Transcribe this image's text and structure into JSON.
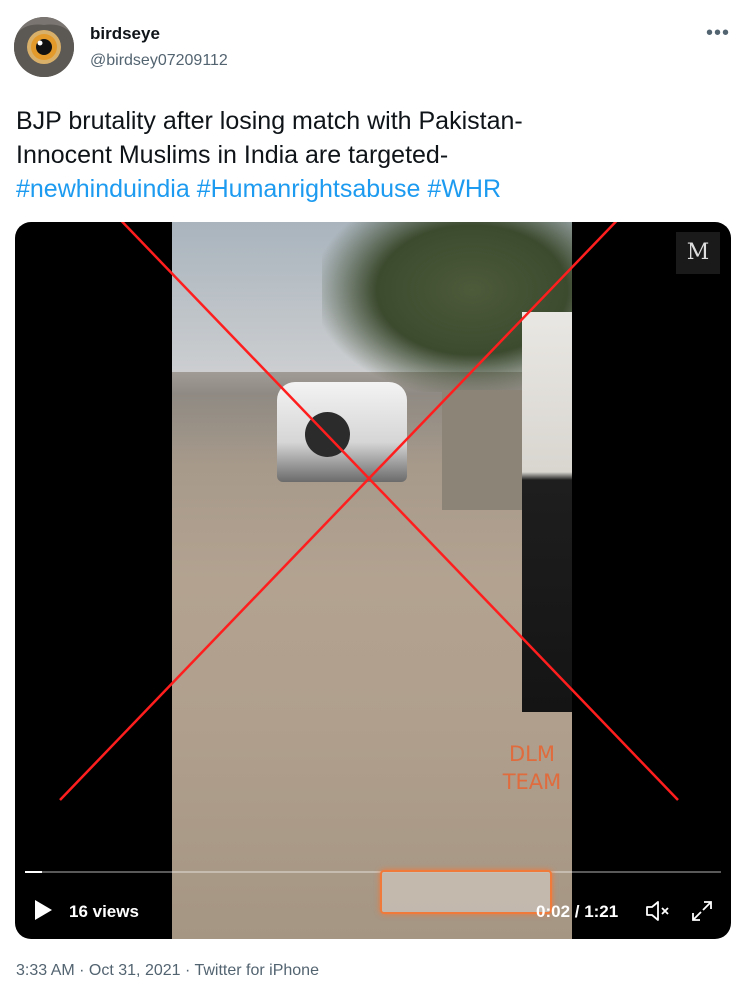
{
  "author": {
    "display_name": "birdseye",
    "handle": "@birdsey07209112"
  },
  "tweet": {
    "line1": "BJP brutality after losing match with Pakistan-",
    "line2": "Innocent Muslims in India are targeted-",
    "hashtags": [
      "#newhinduindia",
      "#Humanrightsabuse",
      "#WHR"
    ]
  },
  "media": {
    "overlay_text": [
      "DLM",
      "TEAM"
    ],
    "views": "16 views",
    "time": "0:02 / 1:21",
    "progress": 0.025,
    "accent_color": "#f07a3a",
    "cross_color": "#ff1e1e",
    "icons": [
      "play-icon",
      "volume-icon",
      "fullscreen-icon"
    ]
  },
  "footer": {
    "meta": "3:33 AM · Oct 31, 2021 · Twitter for iPhone"
  },
  "colors": {
    "text": "#0f1419",
    "secondary": "#536471",
    "link": "#1d9bf0"
  }
}
